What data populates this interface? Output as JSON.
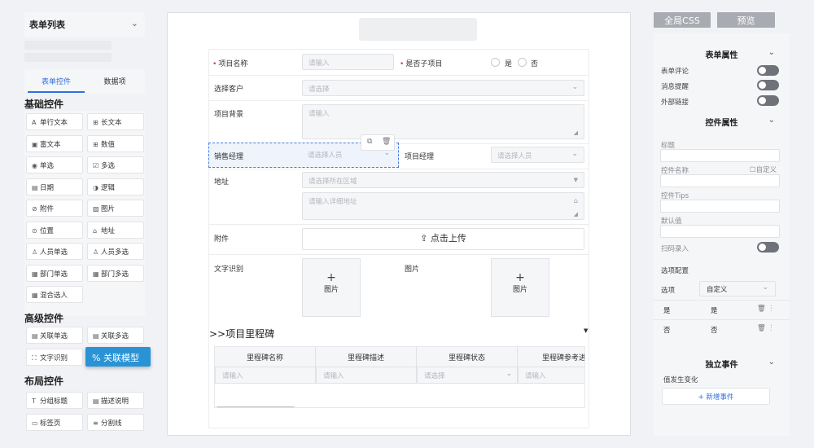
{
  "left": {
    "title": "表单列表",
    "tabs": [
      "表单控件",
      "数据项"
    ],
    "sections": {
      "basic": "基础控件",
      "advanced": "高级控件",
      "layout": "布局控件"
    },
    "basic_controls": [
      {
        "icon": "A",
        "label": "单行文本"
      },
      {
        "icon": "⊞",
        "label": "长文本"
      },
      {
        "icon": "▣",
        "label": "富文本"
      },
      {
        "icon": "⊞",
        "label": "数值"
      },
      {
        "icon": "◉",
        "label": "单选"
      },
      {
        "icon": "☑",
        "label": "多选"
      },
      {
        "icon": "▤",
        "label": "日期"
      },
      {
        "icon": "◑",
        "label": "逻辑"
      },
      {
        "icon": "⊘",
        "label": "附件"
      },
      {
        "icon": "▧",
        "label": "图片"
      },
      {
        "icon": "⊙",
        "label": "位置"
      },
      {
        "icon": "⌂",
        "label": "地址"
      },
      {
        "icon": "♙",
        "label": "人员单选"
      },
      {
        "icon": "♙",
        "label": "人员多选"
      },
      {
        "icon": "▦",
        "label": "部门单选"
      },
      {
        "icon": "▦",
        "label": "部门多选"
      },
      {
        "icon": "▦",
        "label": "混合选人"
      }
    ],
    "advanced_controls": [
      {
        "icon": "▤",
        "label": "关联单选"
      },
      {
        "icon": "▤",
        "label": "关联多选"
      },
      {
        "icon": "⛶",
        "label": "文字识别"
      }
    ],
    "layout_controls": [
      {
        "icon": "T",
        "label": "分组标题"
      },
      {
        "icon": "▤",
        "label": "描述说明"
      },
      {
        "icon": "▭",
        "label": "标签页"
      },
      {
        "icon": "≡",
        "label": "分割线"
      }
    ],
    "tooltip": {
      "icon": "%",
      "label": "关联模型"
    }
  },
  "form": {
    "project_name": {
      "label": "项目名称",
      "placeholder": "请输入"
    },
    "is_sub": {
      "label": "是否子项目",
      "options": [
        "是",
        "否"
      ]
    },
    "customer": {
      "label": "选择客户",
      "placeholder": "请选择"
    },
    "background": {
      "label": "项目背景",
      "placeholder": "请输入"
    },
    "sales_manager": {
      "label": "销售经理",
      "placeholder": "请选择人员"
    },
    "project_manager": {
      "label": "项目经理",
      "placeholder": "请选择人员"
    },
    "address": {
      "label": "地址",
      "region_placeholder": "请选择所在区域",
      "detail_placeholder": "请输入详细地址"
    },
    "attachment": {
      "label": "附件",
      "upload": "点击上传"
    },
    "ocr": {
      "label": "文字识别",
      "box": "图片"
    },
    "image": {
      "label": "图片",
      "box": "图片"
    },
    "milestone": {
      "title": ">>项目里程碑",
      "columns": [
        "里程碑名称",
        "里程碑描述",
        "里程碑状态",
        "里程碑参考进度"
      ],
      "row": [
        "请输入",
        "请输入",
        "请选择",
        "请输入"
      ]
    }
  },
  "top_buttons": {
    "global_css": "全局CSS",
    "preview": "预览"
  },
  "right": {
    "form_props": {
      "title": "表单属性",
      "toggles": [
        "表单评论",
        "消息提醒",
        "外部链接"
      ]
    },
    "control_props": {
      "title": "控件属性",
      "fields": {
        "title": "标题",
        "name": "控件名称",
        "custom": "自定义",
        "tips": "控件Tips",
        "default": "默认值",
        "scan": "扫码录入"
      },
      "options_config": "选项配置",
      "options_label": "选项",
      "options_select": "自定义",
      "options": [
        [
          "是",
          "是"
        ],
        [
          "否",
          "否"
        ]
      ]
    },
    "events": {
      "title": "独立事件",
      "trigger": "值发生变化",
      "add": "+ 新增事件"
    }
  }
}
